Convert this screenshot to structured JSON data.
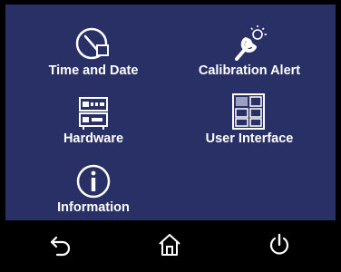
{
  "menu": {
    "items": [
      {
        "id": "time-and-date",
        "label": "Time and Date",
        "icon": "clock-icon"
      },
      {
        "id": "calibration-alert",
        "label": "Calibration Alert",
        "icon": "wrench-alert-icon"
      },
      {
        "id": "hardware",
        "label": "Hardware",
        "icon": "hardware-rack-icon"
      },
      {
        "id": "user-interface",
        "label": "User Interface",
        "icon": "screen-grid-icon"
      },
      {
        "id": "information",
        "label": "Information",
        "icon": "info-icon"
      }
    ]
  },
  "nav": {
    "back_icon": "back-arrow-icon",
    "home_icon": "home-icon",
    "power_icon": "power-icon"
  },
  "colors": {
    "panel": "#283066",
    "background": "#000000",
    "foreground": "#ffffff"
  }
}
